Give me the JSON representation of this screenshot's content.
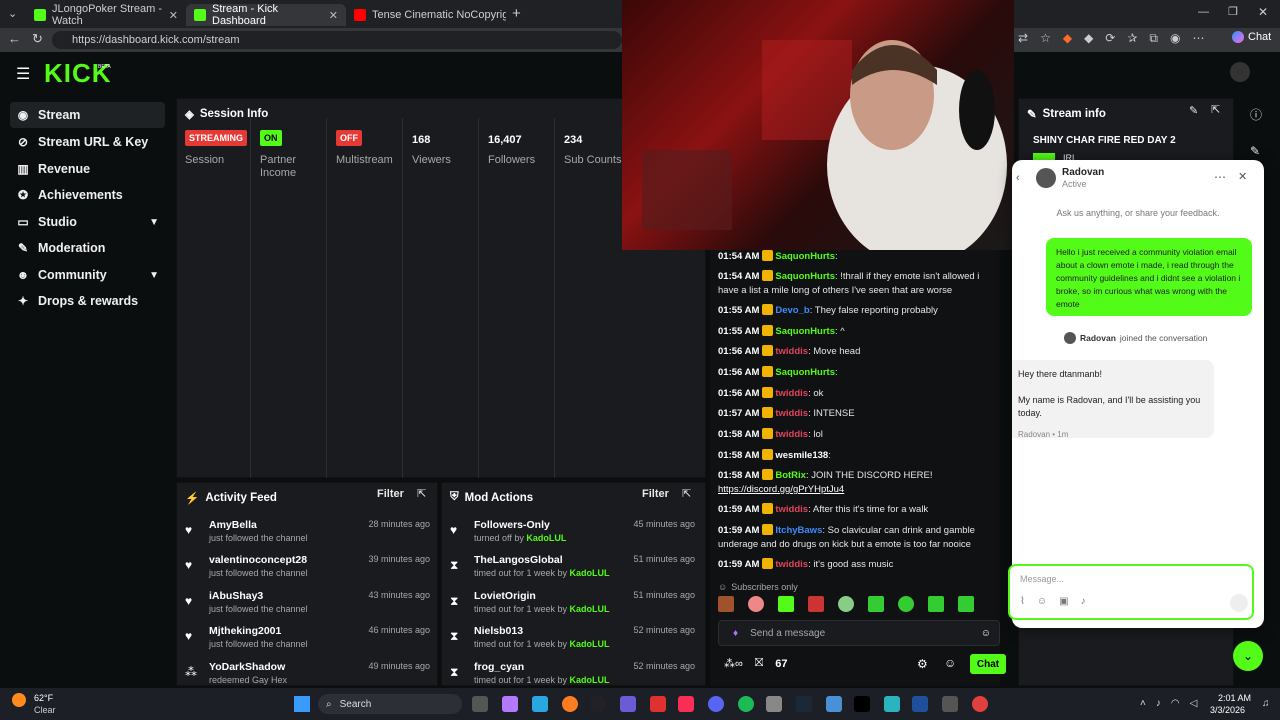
{
  "browser": {
    "tabs": [
      {
        "title": "JLongoPoker Stream - Watch",
        "favicon_color": "#53fc18"
      },
      {
        "title": "Stream - Kick Dashboard",
        "favicon_color": "#53fc18"
      },
      {
        "title": "Tense Cinematic NoCopyright",
        "favicon_color": "#ff0000"
      }
    ],
    "url": "https://dashboard.kick.com/stream",
    "chat_button": "Chat"
  },
  "app": {
    "logo": "KICK",
    "logo_tag": "BETA",
    "accent": "#53fc18"
  },
  "sidebar": {
    "items": [
      {
        "label": "Stream",
        "icon": "broadcast-icon",
        "active": true
      },
      {
        "label": "Stream URL & Key",
        "icon": "link-icon"
      },
      {
        "label": "Revenue",
        "icon": "chart-icon"
      },
      {
        "label": "Achievements",
        "icon": "trophy-icon"
      },
      {
        "label": "Studio",
        "icon": "studio-icon",
        "expandable": true
      },
      {
        "label": "Moderation",
        "icon": "wrench-icon"
      },
      {
        "label": "Community",
        "icon": "people-icon",
        "expandable": true
      },
      {
        "label": "Drops & rewards",
        "icon": "gift-icon"
      }
    ]
  },
  "session": {
    "title": "Session Info",
    "stats": [
      {
        "badge": "STREAMING",
        "badge_color": "#e53935",
        "label": "Session"
      },
      {
        "badge": "ON",
        "badge_color": "#53fc18",
        "label": "Partner Income"
      },
      {
        "badge": "OFF",
        "badge_color": "#e53935",
        "label": "Multistream"
      },
      {
        "value": "168",
        "label": "Viewers"
      },
      {
        "value": "16,407",
        "label": "Followers"
      },
      {
        "value": "234",
        "label": "Sub Counts"
      }
    ]
  },
  "activity_feed": {
    "title": "Activity Feed",
    "filter": "Filter",
    "items": [
      {
        "name": "AmyBella",
        "sub": "just followed the channel",
        "time": "28 minutes ago"
      },
      {
        "name": "valentinoconcept28",
        "sub": "just followed the channel",
        "time": "39 minutes ago"
      },
      {
        "name": "iAbuShay3",
        "sub": "just followed the channel",
        "time": "43 minutes ago"
      },
      {
        "name": "Mjtheking2001",
        "sub": "just followed the channel",
        "time": "46 minutes ago"
      },
      {
        "name": "YoDarkShadow",
        "sub": "redeemed Gay Hex",
        "time": "49 minutes ago"
      }
    ]
  },
  "mod_actions": {
    "title": "Mod Actions",
    "filter": "Filter",
    "items": [
      {
        "name": "Followers-Only",
        "sub_prefix": "turned off by ",
        "by": "KadoLUL",
        "time": "45 minutes ago",
        "icon": "heart-icon"
      },
      {
        "name": "TheLangosGlobal",
        "sub_prefix": "timed out for 1 week by ",
        "by": "KadoLUL",
        "time": "51 minutes ago",
        "icon": "hourglass-icon"
      },
      {
        "name": "LovietOrigin",
        "sub_prefix": "timed out for 1 week by ",
        "by": "KadoLUL",
        "time": "51 minutes ago",
        "icon": "hourglass-icon"
      },
      {
        "name": "Nielsb013",
        "sub_prefix": "timed out for 1 week by ",
        "by": "KadoLUL",
        "time": "52 minutes ago",
        "icon": "hourglass-icon"
      },
      {
        "name": "frog_cyan",
        "sub_prefix": "timed out for 1 week by ",
        "by": "KadoLUL",
        "time": "52 minutes ago",
        "icon": "hourglass-icon"
      }
    ]
  },
  "stream_info": {
    "title": "Stream info",
    "stream_title": "SHINY CHAR FIRE RED DAY 2",
    "category": "IRL"
  },
  "chat": {
    "messages": [
      {
        "time": "01:54 AM",
        "user": "SaquonHurts",
        "color": "#53fc18",
        "text": ""
      },
      {
        "time": "01:54 AM",
        "user": "SaquonHurts",
        "color": "#53fc18",
        "text": "!thrall if they emote isn't allowed i have a list a mile long of others I've seen that are worse"
      },
      {
        "time": "01:55 AM",
        "user": "Devo_b",
        "color": "#3d8bfd",
        "text": "They false reporting probably"
      },
      {
        "time": "01:55 AM",
        "user": "SaquonHurts",
        "color": "#53fc18",
        "text": "^"
      },
      {
        "time": "01:56 AM",
        "user": "twiddis",
        "color": "#e0445b",
        "text": "Move head"
      },
      {
        "time": "01:56 AM",
        "user": "SaquonHurts",
        "color": "#53fc18",
        "text": ""
      },
      {
        "time": "01:56 AM",
        "user": "twiddis",
        "color": "#e0445b",
        "text": "ok"
      },
      {
        "time": "01:57 AM",
        "user": "twiddis",
        "color": "#e0445b",
        "text": "INTENSE"
      },
      {
        "time": "01:58 AM",
        "user": "twiddis",
        "color": "#e0445b",
        "text": "lol"
      },
      {
        "time": "01:58 AM",
        "user": "wesmile138",
        "color": "#ffffff",
        "text": ""
      },
      {
        "time": "01:58 AM",
        "user": "BotRix",
        "color": "#53fc18",
        "text": "JOIN THE DISCORD HERE!",
        "link": "https://discord.gg/gPrYHptJu4"
      },
      {
        "time": "01:59 AM",
        "user": "twiddis",
        "color": "#e0445b",
        "text": "After this it's time for a walk"
      },
      {
        "time": "01:59 AM",
        "user": "ItchyBaws",
        "color": "#3d8bfd",
        "text": "So clavicular can drink and gamble underage and do drugs on kick but a emote is too far nooice"
      },
      {
        "time": "01:59 AM",
        "user": "twiddis",
        "color": "#e0445b",
        "text": "it's good ass music"
      }
    ],
    "subs_only": "Subscribers only",
    "placeholder": "Send a message",
    "viewer_count": "67",
    "chat_button": "Chat"
  },
  "support": {
    "agent_name": "Radovan",
    "agent_status": "Active",
    "intro": "Ask us anything, or share your feedback.",
    "user_message": "Hello i just received a community violation email about a clown emote i made, i read through the community guidelines and i didnt see a violation i broke, so im curious what was wrong with the emote",
    "joined_name": "Radovan",
    "joined_suffix": " joined the conversation",
    "agent_line1": "Hey there dtanmanb!",
    "agent_line2": "My name is Radovan, and I'll be assisting you today.",
    "agent_meta": "Radovan • 1m",
    "input_placeholder": "Message..."
  },
  "taskbar": {
    "weather_temp": "62°F",
    "weather_desc": "Clear",
    "search": "Search",
    "time": "2:01 AM",
    "date": "3/3/2026"
  }
}
